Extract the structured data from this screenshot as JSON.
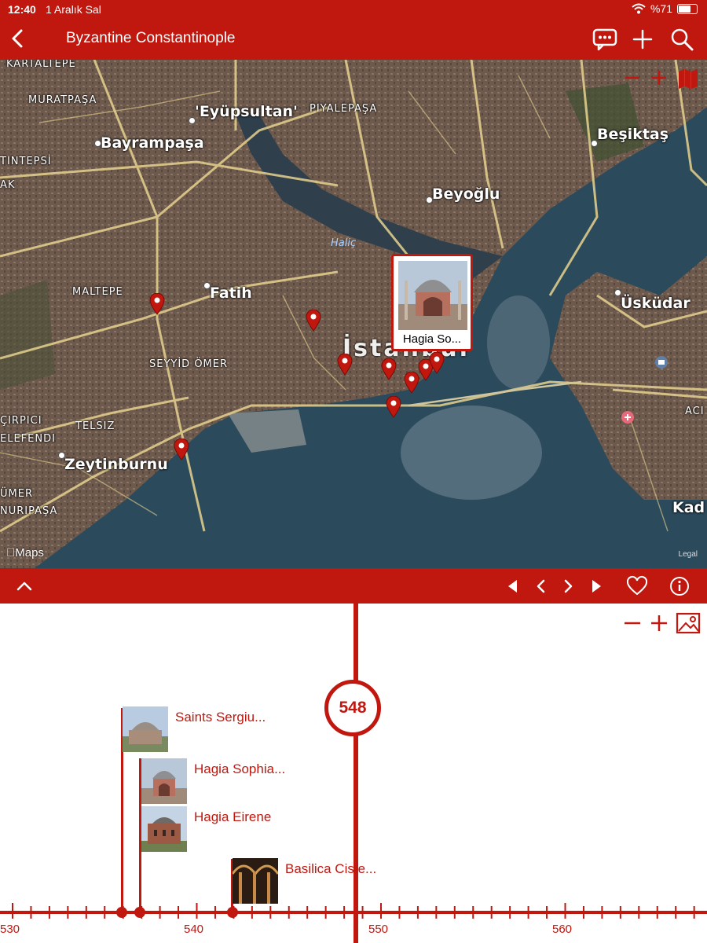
{
  "status_bar": {
    "time": "12:40",
    "date": "1 Aralık Sal",
    "battery": "%71"
  },
  "nav": {
    "title": "Byzantine Constantinople",
    "icons": [
      "chevron-left-icon",
      "comment-icon",
      "plus-icon",
      "search-icon"
    ]
  },
  "map": {
    "labels": {
      "kartaltepe": "KARTALTEPE",
      "muratpasa": "MURATPAŞA",
      "eyupsultan": "'Eyüpsultan'",
      "piyalepasa": "PIYALEPAŞA",
      "bayrampasa": "Bayrampaşa",
      "besiktas": "Beşiktaş",
      "tintepsi": "TINTEPSİ",
      "ak": "AK",
      "beyoglu": "Beyoğlu",
      "halic": "Haliç",
      "maltepe": "MALTEPE",
      "fatih": "Fatih",
      "istanbul": "İstanbul",
      "uskudar": "Üsküdar",
      "seyyidomer": "SEYYİD ÖMER",
      "cirpici": "ÇIRPICI",
      "telsiz": "TELSIZ",
      "elefendi": "ELEFENDI",
      "zeytinburnu": "Zeytinburnu",
      "umer": "ÜMER",
      "nuripasa": "NURIPAŞA",
      "aci": "ACI",
      "kad": "Kad"
    },
    "callout": "Hagia So...",
    "attribution": "Maps",
    "legal": "Legal"
  },
  "timeline": {
    "current_year": "548",
    "events": [
      {
        "title": "Saints Sergiu..."
      },
      {
        "title": "Hagia Sophia..."
      },
      {
        "title": "Hagia Eirene"
      },
      {
        "title": "Basilica Ciste..."
      }
    ],
    "ticks": [
      "530",
      "540",
      "550",
      "560"
    ]
  },
  "colors": {
    "accent": "#c0170f",
    "water": "#2b4a5c"
  }
}
